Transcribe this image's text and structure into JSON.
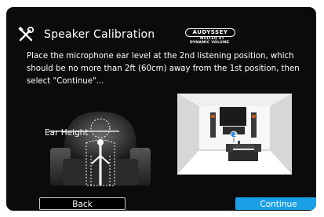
{
  "header": {
    "title": "Speaker Calibration",
    "icon": "tools-icon"
  },
  "logo": {
    "brand": "AUDYSSEY",
    "line1": "MULTEQ XT",
    "line2": "DYNAMIC VOLUME"
  },
  "instructions": "Place the microphone ear level at the 2nd listening position, which should be no more than 2ft (60cm) away from the 1st position, then select \"Continue\"...",
  "illustration": {
    "ear_height_label": "Ear Height",
    "position_marker": "2"
  },
  "buttons": {
    "back": "Back",
    "continue": "Continue"
  },
  "colors": {
    "background": "#0b0b0b",
    "accent": "#1ba0e6",
    "text": "#ffffff"
  }
}
